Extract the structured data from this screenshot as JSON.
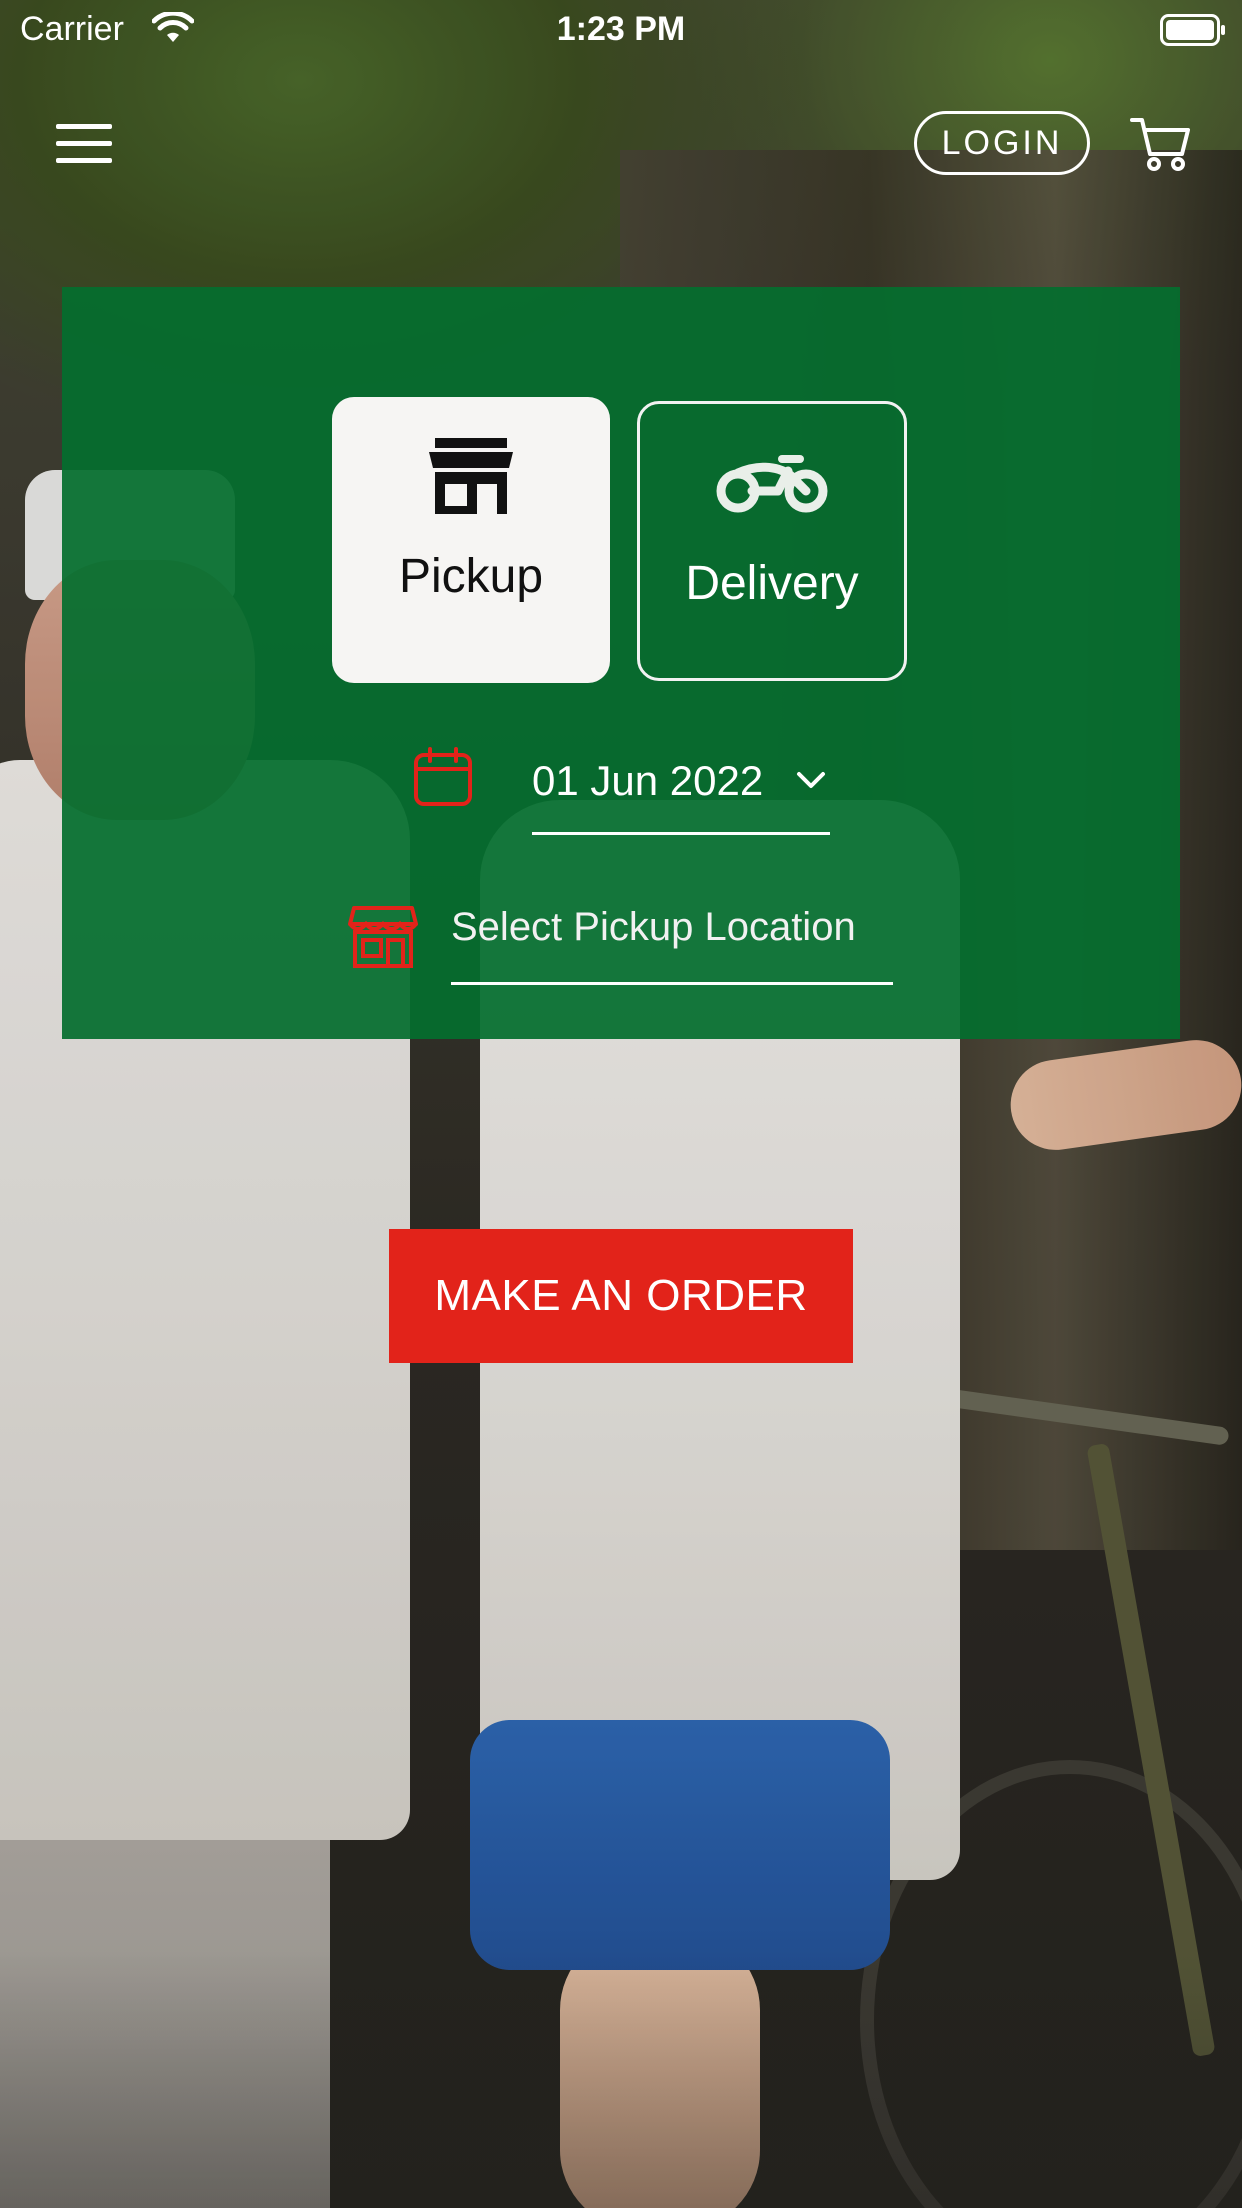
{
  "status_bar": {
    "carrier": "Carrier",
    "time": "1:23 PM"
  },
  "nav": {
    "menu_icon": "hamburger-menu-icon",
    "login_label": "LOGIN",
    "cart_icon": "shopping-cart-icon"
  },
  "order_panel": {
    "background_color": "#046e2e",
    "modes": [
      {
        "label": "Pickup",
        "icon": "storefront-icon",
        "selected": true
      },
      {
        "label": "Delivery",
        "icon": "motorbike-icon",
        "selected": false
      }
    ],
    "date": {
      "icon": "calendar-icon",
      "value": "01 Jun 2022",
      "dropdown_icon": "chevron-down-icon"
    },
    "location": {
      "icon": "store-icon",
      "placeholder": "Select Pickup Location"
    }
  },
  "cta": {
    "label": "MAKE AN ORDER",
    "color": "#e2231a"
  },
  "accent_color": "#e2231a"
}
